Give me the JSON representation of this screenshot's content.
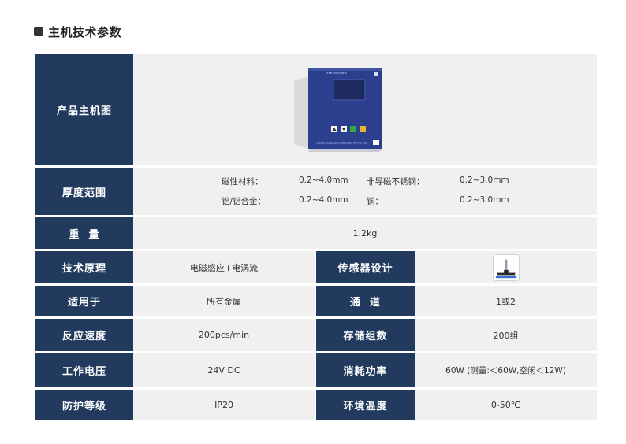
{
  "section": {
    "title": "主机技术参数"
  },
  "image_row": {
    "label": "产品主机图",
    "device": {
      "screen_brand": "STEEL THICKNESS",
      "footer_text": "ANTONG ZHONGXIANG INTELLIGENT TECH CO.,LTD"
    }
  },
  "thickness": {
    "label": "厚度范围",
    "items": [
      {
        "name": "磁性材料：",
        "value": "0.2~4.0mm"
      },
      {
        "name": "非导磁不锈钢：",
        "value": "0.2~3.0mm"
      },
      {
        "name": "铝/铝合金：",
        "value": "0.2~4.0mm"
      },
      {
        "name": "铜：",
        "value": "0.2~3.0mm"
      }
    ]
  },
  "weight": {
    "label": "重  量",
    "value": "1.2kg"
  },
  "rows": [
    {
      "l_label": "技术原理",
      "l_value": "电磁感应+电涡流",
      "r_label": "传感器设计",
      "r_value": "",
      "r_icon": "sensor-icon"
    },
    {
      "l_label": "适用于",
      "l_value": "所有金属",
      "r_label": "通  道",
      "r_value": "1或2"
    },
    {
      "l_label": "反应速度",
      "l_value": "200pcs/min",
      "r_label": "存储组数",
      "r_value": "200组"
    },
    {
      "l_label": "工作电压",
      "l_value": "24V DC",
      "r_label": "消耗功率",
      "r_value": "60W (测量:＜60W,空闲＜12W)"
    },
    {
      "l_label": "防护等级",
      "l_value": "IP20",
      "r_label": "环境温度",
      "r_value": "0-50℃"
    }
  ],
  "colors": {
    "header": "#223a5e",
    "cell": "#f0f0f0",
    "divider": "#ffffff"
  }
}
